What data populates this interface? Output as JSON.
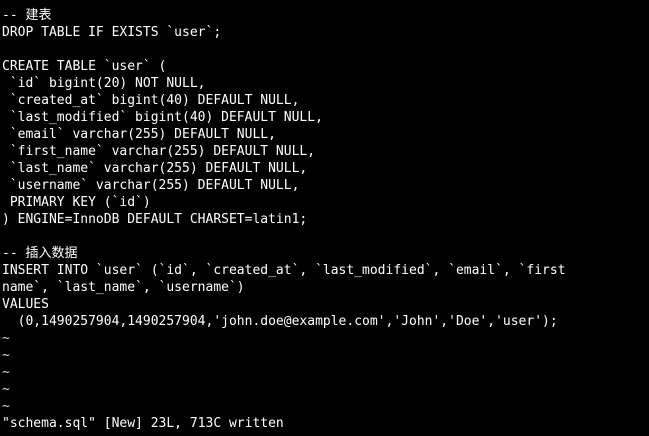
{
  "editor": {
    "lines": [
      "-- 建表",
      "DROP TABLE IF EXISTS `user`;",
      "",
      "CREATE TABLE `user` (",
      " `id` bigint(20) NOT NULL,",
      " `created_at` bigint(40) DEFAULT NULL,",
      " `last_modified` bigint(40) DEFAULT NULL,",
      " `email` varchar(255) DEFAULT NULL,",
      " `first_name` varchar(255) DEFAULT NULL,",
      " `last_name` varchar(255) DEFAULT NULL,",
      " `username` varchar(255) DEFAULT NULL,",
      " PRIMARY KEY (`id`)",
      ") ENGINE=InnoDB DEFAULT CHARSET=latin1;",
      "",
      "-- 插入数据",
      "INSERT INTO `user` (`id`, `created_at`, `last_modified`, `email`, `first",
      "name`, `last_name`, `username`)",
      "VALUES",
      "  (0,1490257904,1490257904,'john.doe@example.com','John','Doe','user');"
    ],
    "empty_markers": [
      "~",
      "~",
      "~",
      "~",
      "~"
    ]
  },
  "status_line": {
    "message": "\"schema.sql\" [New] 23L, 713C written"
  },
  "colors": {
    "background": "#000000",
    "text": "#ffffff"
  }
}
